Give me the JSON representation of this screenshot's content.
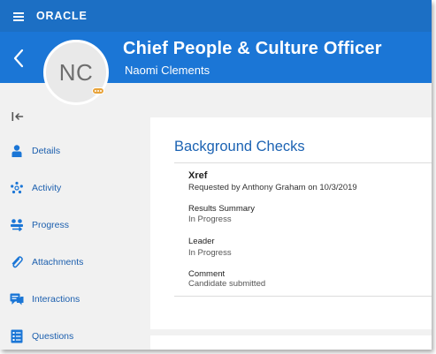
{
  "app": {
    "brand": "ORACLE"
  },
  "header": {
    "title": "Chief People & Culture Officer",
    "subtitle": "Naomi Clements",
    "avatar_initials": "NC"
  },
  "sidebar": {
    "items": [
      {
        "label": "Details",
        "icon": "person-icon"
      },
      {
        "label": "Activity",
        "icon": "activity-icon"
      },
      {
        "label": "Progress",
        "icon": "progress-icon"
      },
      {
        "label": "Attachments",
        "icon": "paperclip-icon"
      },
      {
        "label": "Interactions",
        "icon": "interactions-icon"
      },
      {
        "label": "Questions",
        "icon": "questions-icon"
      }
    ]
  },
  "section": {
    "title": "Background Checks",
    "xref": "Xref",
    "requested_by": "Requested by Anthony Graham  on 10/3/2019",
    "results_summary_label": "Results Summary",
    "results_summary_value": "In Progress",
    "leader_label": "Leader",
    "leader_value": "In Progress",
    "comment_label": "Comment",
    "comment_value": "Candidate submitted"
  },
  "colors": {
    "topbar": "#1c6fc4",
    "header": "#1b76d6",
    "link": "#1c5fae",
    "icon": "#1b76d6",
    "status_dot": "#e8a33a"
  }
}
